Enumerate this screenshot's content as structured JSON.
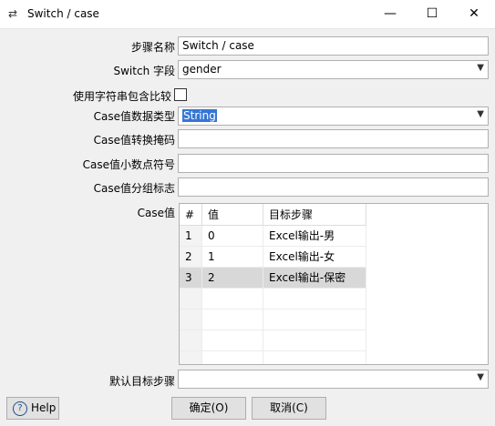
{
  "window": {
    "icon": "transition-arrows-icon",
    "title": "Switch / case"
  },
  "form": {
    "step_name_label": "步骤名称",
    "step_name_value": "Switch / case",
    "switch_field_label": "Switch 字段",
    "switch_field_value": "gender",
    "contains_compare_label": "使用字符串包含比较",
    "case_type_label": "Case值数据类型",
    "case_type_value": "String",
    "case_mask_label": "Case值转换掩码",
    "case_mask_value": "",
    "case_decimal_label": "Case值小数点符号",
    "case_decimal_value": "",
    "case_group_label": "Case值分组标志",
    "case_group_value": "",
    "case_values_label": "Case值",
    "default_target_label": "默认目标步骤",
    "default_target_value": ""
  },
  "table": {
    "headers": [
      "#",
      "值",
      "目标步骤"
    ],
    "rows": [
      [
        "1",
        "0",
        "Excel输出-男"
      ],
      [
        "2",
        "1",
        "Excel输出-女"
      ],
      [
        "3",
        "2",
        "Excel输出-保密"
      ]
    ]
  },
  "buttons": {
    "help": "Help",
    "ok": "确定(O)",
    "cancel": "取消(C)"
  }
}
